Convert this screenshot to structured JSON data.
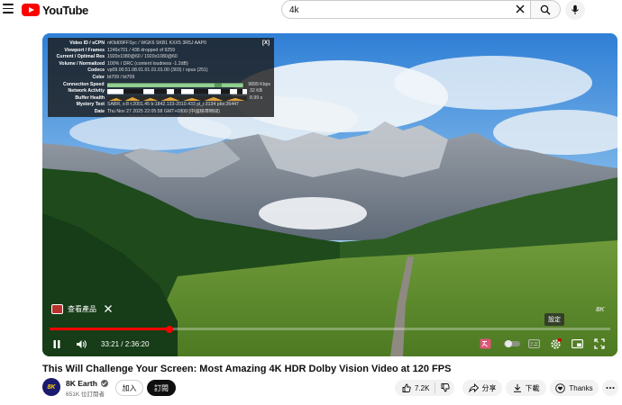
{
  "header": {
    "logo_text": "YouTube",
    "search_value": "4k",
    "search_placeholder": "搜尋"
  },
  "stats": {
    "close_label": "[X]",
    "rows": [
      {
        "label": "Video ID / sCPN",
        "value": "nK9d09FFSyc / WGK6 SKB1 KXX5 3R5J AAP0"
      },
      {
        "label": "Viewport / Frames",
        "value": "1246x701 / 438 dropped of 9259"
      },
      {
        "label": "Current / Optimal Res",
        "value": "1920x1080@60 / 1920x1080@60"
      },
      {
        "label": "Volume / Normalized",
        "value": "100% / DRC (content loudness -1.2dB)"
      },
      {
        "label": "Codecs",
        "value": "vp09.00.51.08.01.01.01.01.00 (303) / opus (251)"
      },
      {
        "label": "Color",
        "value": "bt709 / bt709"
      },
      {
        "label": "Connection Speed",
        "value": "9899 Kbps"
      },
      {
        "label": "Network Activity",
        "value": "32 KB"
      },
      {
        "label": "Buffer Health",
        "value": "8.99 s"
      },
      {
        "label": "Mystery Text",
        "value": "SABR, s:8 t:2001.45 b:1842.133-2010.433 pl_i:3134 pbs:26447"
      },
      {
        "label": "Date",
        "value": "Thu Nov 27 2025 22:05:58 GMT+0800 (中國標準時間)"
      }
    ]
  },
  "player": {
    "product_chip_label": "查看產品",
    "settings_tooltip": "設定",
    "watermark": "8K",
    "time_current": "33:21",
    "time_total": "2:36:20",
    "progress_fraction": 0.2133,
    "colors": {
      "progress": "#ff0000",
      "buffer_health": "#e0a33a",
      "connection": "#8fd08f"
    }
  },
  "video": {
    "title": "This Will Challenge Your Screen: Most Amazing 4K HDR Dolby Vision Video at 120 FPS",
    "channel_name": "8K Earth",
    "channel_avatar_text": "8K",
    "subscribers": "651K 位訂閱者",
    "join_label": "加入",
    "subscribe_label": "訂閱",
    "like_count": "7.2K",
    "share_label": "分享",
    "download_label": "下載",
    "thanks_label": "Thanks"
  }
}
